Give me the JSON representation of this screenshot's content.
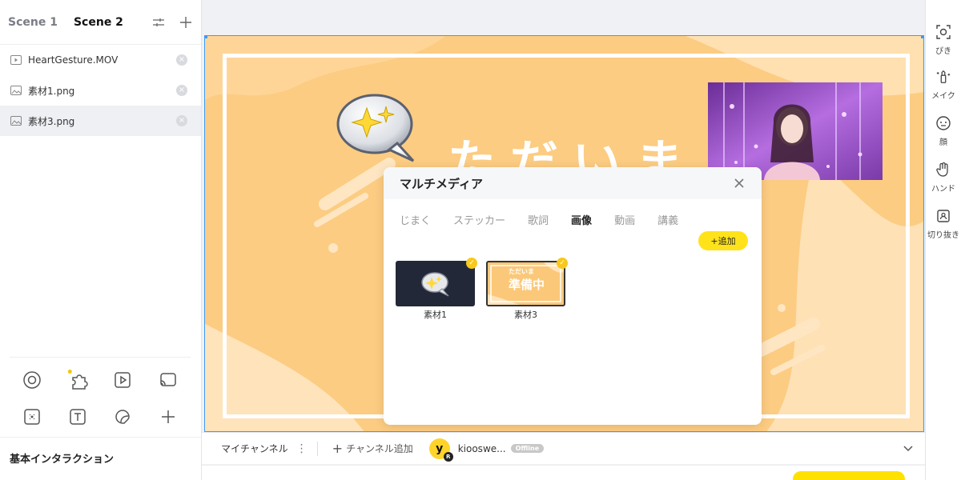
{
  "scenes": [
    {
      "label": "Scene 1",
      "active": false
    },
    {
      "label": "Scene 2",
      "active": true
    }
  ],
  "assets": [
    {
      "name": "HeartGesture.MOV",
      "type": "video"
    },
    {
      "name": "素材1.png",
      "type": "image"
    },
    {
      "name": "素材3.png",
      "type": "image",
      "selected": true
    }
  ],
  "left_tools_section": {
    "title": "基本インタラクション"
  },
  "stage": {
    "title_text": "ただいま"
  },
  "right_tools": [
    {
      "label": "ぴき",
      "icon": "face-scan-icon"
    },
    {
      "label": "メイク",
      "icon": "makeup-icon"
    },
    {
      "label": "顔",
      "icon": "face-icon"
    },
    {
      "label": "ハンド",
      "icon": "hand-icon"
    },
    {
      "label": "切り抜き",
      "icon": "cutout-icon"
    }
  ],
  "bottom_bar": {
    "channel_label": "マイチャンネル",
    "add_channel_label": "チャンネル追加",
    "avatar_letter": "y",
    "avatar_badge": "R",
    "username": "kiooswe...",
    "status": "Offline"
  },
  "modal": {
    "title": "マルチメディア",
    "tabs": [
      {
        "label": "じまく",
        "active": false
      },
      {
        "label": "ステッカー",
        "active": false
      },
      {
        "label": "歌詞",
        "active": false
      },
      {
        "label": "画像",
        "active": true
      },
      {
        "label": "動画",
        "active": false
      },
      {
        "label": "講義",
        "active": false
      }
    ],
    "add_button": "+追加",
    "thumbnails": [
      {
        "label": "素材1",
        "checked": true
      },
      {
        "label": "素材3",
        "checked": true,
        "mini_text": "ただいま",
        "mini_main": "準備中"
      }
    ]
  },
  "colors": {
    "accent_yellow": "#ffe21a",
    "stage_bg": "#fccc82",
    "selection_blue": "#3d9bf0"
  }
}
